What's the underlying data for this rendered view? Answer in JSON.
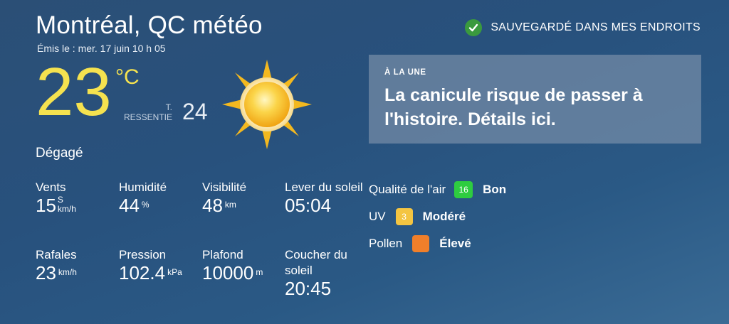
{
  "header": {
    "title": "Montréal, QC météo",
    "issued": "Émis le : mer. 17 juin 10 h 05",
    "saved_label": "SAUVEGARDÉ DANS MES ENDROITS",
    "saved_icon": "check-circle-icon"
  },
  "current": {
    "temperature": "23",
    "unit": "°C",
    "feels_label_line1": "T.",
    "feels_label_line2": "RESSENTIE",
    "feels_value": "24",
    "condition": "Dégagé",
    "condition_icon": "sun-icon"
  },
  "stats": {
    "wind": {
      "label": "Vents",
      "value": "15",
      "direction": "S",
      "unit": "km/h"
    },
    "humidity": {
      "label": "Humidité",
      "value": "44",
      "unit": "%"
    },
    "visibility": {
      "label": "Visibilité",
      "value": "48",
      "unit": "km"
    },
    "sunrise": {
      "label": "Lever du soleil",
      "value": "05:04"
    },
    "gusts": {
      "label": "Rafales",
      "value": "23",
      "unit": "km/h"
    },
    "pressure": {
      "label": "Pression",
      "value": "102.4",
      "unit": "kPa"
    },
    "ceiling": {
      "label": "Plafond",
      "value": "10000",
      "unit": "m"
    },
    "sunset": {
      "label": "Coucher du soleil",
      "value": "20:45"
    }
  },
  "news": {
    "kicker": "À LA UNE",
    "headline": "La canicule risque de passer à l'histoire. Détails ici."
  },
  "air": {
    "aqi": {
      "label": "Qualité de l'air",
      "badge": "16",
      "value": "Bon",
      "color": "#2ecc40"
    },
    "uv": {
      "label": "UV",
      "badge": "3",
      "value": "Modéré",
      "color": "#f4c542"
    },
    "pollen": {
      "label": "Pollen",
      "badge": "",
      "value": "Élevé",
      "color": "#f07f2a"
    }
  }
}
